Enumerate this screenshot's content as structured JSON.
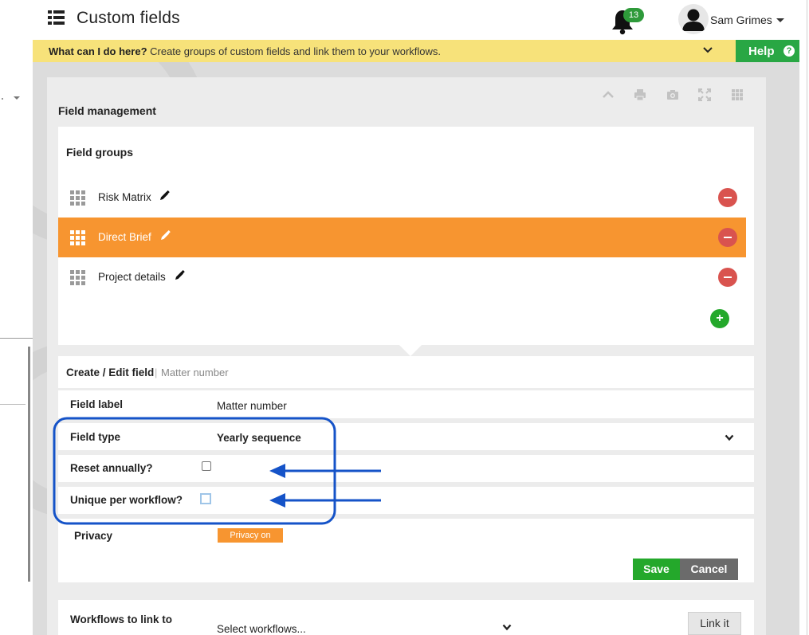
{
  "header": {
    "title": "Custom fields",
    "notifications_count": "13",
    "user_name": "Sam Grimes"
  },
  "hint": {
    "question": "What can I do here?",
    "text": " Create groups of custom fields and link them to your workflows."
  },
  "help": {
    "label": "Help",
    "icon": "?"
  },
  "card": {
    "title": "Field management"
  },
  "groups": {
    "title": "Field groups",
    "items": [
      {
        "label": "Risk Matrix",
        "active": false
      },
      {
        "label": "Direct Brief",
        "active": true
      },
      {
        "label": "Project details",
        "active": false
      }
    ],
    "add_symbol": "+"
  },
  "edit": {
    "title": "Create / Edit field",
    "separator": "|",
    "subtitle": "Matter number",
    "field_label": {
      "label": "Field label",
      "value": "Matter number"
    },
    "field_type": {
      "label": "Field type",
      "value": "Yearly sequence"
    },
    "reset_annually": {
      "label": "Reset annually?",
      "checked": false
    },
    "unique_per_workflow": {
      "label": "Unique per workflow?",
      "checked": false
    },
    "privacy": {
      "label": "Privacy",
      "button": "Privacy on"
    },
    "save": "Save",
    "cancel": "Cancel"
  },
  "workflows": {
    "label": "Workflows to link to",
    "placeholder": "Select workflows...",
    "link_button": "Link it"
  },
  "colors": {
    "accent_orange": "#f79530",
    "green": "#24a82b",
    "danger": "#d9534f",
    "hint_yellow": "#f7e27a",
    "annotation_blue": "#1553c8"
  }
}
